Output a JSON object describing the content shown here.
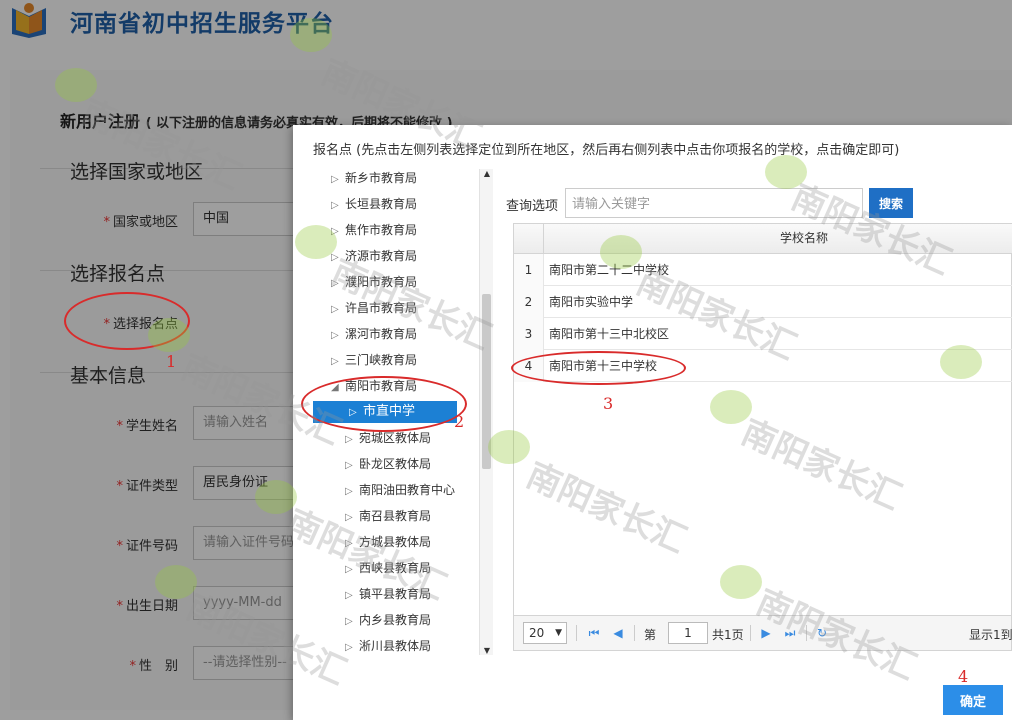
{
  "site": {
    "title": "河南省初中招生服务平台"
  },
  "registration": {
    "title": "新用户注册",
    "note": "( 以下注册的信息请务必真实有效，后期将不能修改 )"
  },
  "sections": {
    "country": "选择国家或地区",
    "enroll_point": "选择报名点",
    "basic_info": "基本信息"
  },
  "fields": {
    "country": {
      "label": "国家或地区",
      "value": "中国"
    },
    "enroll_point": {
      "label": "选择报名点"
    },
    "student_name": {
      "label": "学生姓名",
      "placeholder": "请输入姓名"
    },
    "id_type": {
      "label": "证件类型",
      "value": "居民身份证"
    },
    "id_number": {
      "label": "证件号码",
      "placeholder": "请输入证件号码"
    },
    "birth_date": {
      "label": "出生日期",
      "placeholder": "yyyy-MM-dd"
    },
    "gender": {
      "label": "性　别",
      "placeholder": "--请选择性别--"
    }
  },
  "modal": {
    "title": "报名点 (先点击左侧列表选择定位到所在地区，然后再右侧列表中点击你项报名的学校，点击确定即可)",
    "tree": [
      {
        "label": "新乡市教育局",
        "expanded": false,
        "level": 1
      },
      {
        "label": "长垣县教育局",
        "expanded": false,
        "level": 1
      },
      {
        "label": "焦作市教育局",
        "expanded": false,
        "level": 1
      },
      {
        "label": "济源市教育局",
        "expanded": false,
        "level": 1
      },
      {
        "label": "濮阳市教育局",
        "expanded": false,
        "level": 1
      },
      {
        "label": "许昌市教育局",
        "expanded": false,
        "level": 1
      },
      {
        "label": "漯河市教育局",
        "expanded": false,
        "level": 1
      },
      {
        "label": "三门峡教育局",
        "expanded": false,
        "level": 1
      },
      {
        "label": "南阳市教育局",
        "expanded": true,
        "level": 1
      },
      {
        "label": "市直中学",
        "selected": true,
        "level": 2
      },
      {
        "label": "宛城区教体局",
        "level": 2
      },
      {
        "label": "卧龙区教体局",
        "level": 2
      },
      {
        "label": "南阳油田教育中心",
        "level": 2
      },
      {
        "label": "南召县教育局",
        "level": 2
      },
      {
        "label": "方城县教体局",
        "level": 2
      },
      {
        "label": "西峡县教育局",
        "level": 2
      },
      {
        "label": "镇平县教育局",
        "level": 2
      },
      {
        "label": "内乡县教育局",
        "level": 2
      },
      {
        "label": "淅川县教体局",
        "level": 2
      }
    ],
    "search": {
      "label": "查询选项",
      "placeholder": "请输入关键字",
      "button": "搜索"
    },
    "grid": {
      "column_header": "学校名称",
      "rows": [
        {
          "num": "1",
          "name": "南阳市第二十二中学校"
        },
        {
          "num": "2",
          "name": "南阳市实验中学"
        },
        {
          "num": "3",
          "name": "南阳市第十三中北校区"
        },
        {
          "num": "4",
          "name": "南阳市第十三中学校"
        }
      ]
    },
    "pager": {
      "page_size": "20",
      "page_label": "第",
      "page_number": "1",
      "total_pages": "共1页",
      "display": "显示1到"
    },
    "confirm": "确定"
  },
  "annotations": [
    "1",
    "2",
    "3",
    "4"
  ],
  "watermark": "南阳家长汇",
  "colors": {
    "brand_blue": "#1f5fa8",
    "selected_blue": "#1c80d4",
    "annotation_red": "#d92b2b",
    "required_red": "#e33333"
  }
}
